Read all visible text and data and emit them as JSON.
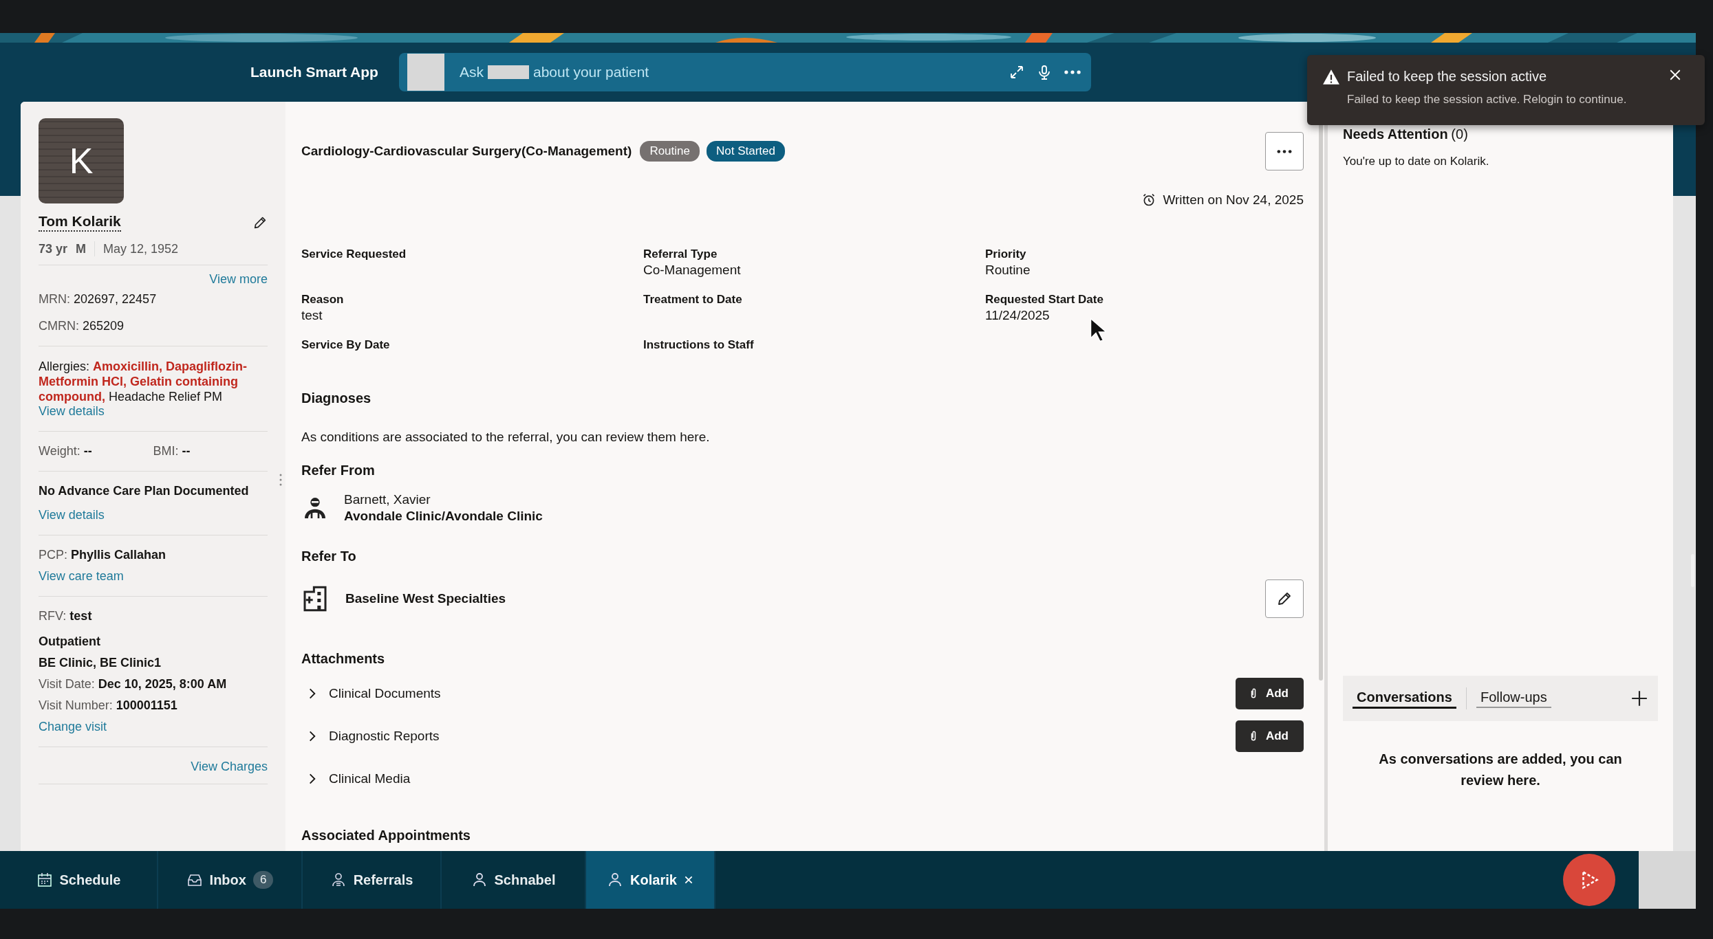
{
  "header": {
    "launch_label": "Launch Smart App",
    "assistant": {
      "prompt_before": "Ask",
      "prompt_after": "about your patient"
    }
  },
  "toast": {
    "title": "Failed to keep the session active",
    "message": "Failed to keep the session active. Relogin to continue."
  },
  "patient": {
    "initial": "K",
    "name": "Tom Kolarik",
    "age": "73 yr",
    "sex": "M",
    "birth_date": "May 12, 1952",
    "view_more": "View more",
    "ids": [
      {
        "label": "MRN:",
        "value": "202697, 22457"
      },
      {
        "label": "CMRN:",
        "value": "265209"
      }
    ],
    "allergies": "Allergies: **Amoxicillin, Dapagliflozin-Metformin HCl, Gelatin containing compound,** Headache Relief PM",
    "allergies_link": "View details",
    "measures": [
      {
        "label": "Weight:",
        "value": "--"
      },
      {
        "label": "BMI:",
        "value": "--"
      }
    ],
    "care_plan": "No Advance Care Plan Documented",
    "care_plan_link": "View details",
    "pcp": {
      "label": "PCP:",
      "value": "Phyllis Callahan"
    },
    "care_team_link": "View care team",
    "rfv": {
      "label": "RFV:",
      "value": "test"
    },
    "encounter_type": "Outpatient",
    "location": "BE Clinic, BE Clinic1",
    "visit": [
      {
        "label": "Visit Date:",
        "value": "Dec 10, 2025, 8:00 AM"
      },
      {
        "label": "Visit Number:",
        "value": "100001151"
      }
    ],
    "change_visit": "Change visit",
    "view_charges": "View Charges"
  },
  "referral": {
    "title": "Cardiology-Cardiovascular Surgery(Co-Management)",
    "badges": [
      {
        "label": "Routine",
        "color": "#767170"
      },
      {
        "label": "Not Started",
        "color": "#0d5e80"
      }
    ],
    "written": "Written on Nov 24, 2025",
    "fields": [
      {
        "label": "Service Requested"
      },
      {
        "label": "Referral Type",
        "value": "Co-Management"
      },
      {
        "label": "Priority",
        "value": "Routine"
      },
      {
        "label": "Reason",
        "value": "test"
      },
      {
        "label": "Treatment to Date"
      },
      {
        "label": "Requested Start Date",
        "value": "11/24/2025"
      },
      {
        "label": "Service By Date"
      },
      {
        "label": "Instructions to Staff"
      }
    ],
    "diagnoses": {
      "heading": "Diagnoses",
      "empty": "As conditions are associated to the referral, you can review them here."
    },
    "refer_from": {
      "heading": "Refer From",
      "name": "Barnett, Xavier",
      "organization": "Avondale Clinic/Avondale Clinic"
    },
    "refer_to": {
      "heading": "Refer To",
      "organization": "Baseline West Specialties"
    },
    "attachments": {
      "heading": "Attachments",
      "items": [
        {
          "label": "Clinical Documents",
          "expanded": false,
          "action": "Add"
        },
        {
          "label": "Diagnostic Reports",
          "expanded": false,
          "action": "Add"
        },
        {
          "label": "Clinical Media",
          "expanded": false
        }
      ]
    },
    "appointments_heading": "Associated Appointments"
  },
  "side": {
    "attention_title": "Needs Attention",
    "attention_count": "(0)",
    "attention_text": "You're up to date on Kolarik.",
    "tabs": [
      {
        "label": "Conversations",
        "selected": true
      },
      {
        "label": "Follow-ups",
        "selected": false
      }
    ],
    "empty": "As conversations are added, you can review here."
  },
  "bottom_nav": {
    "tabs": [
      {
        "label": "Schedule",
        "kind": "schedule",
        "selected": false,
        "closable": false
      },
      {
        "label": "Inbox",
        "kind": "inbox",
        "count": "6",
        "selected": false,
        "closable": false
      },
      {
        "label": "Referrals",
        "kind": "worklist",
        "selected": false,
        "closable": false
      },
      {
        "label": "Schnabel",
        "kind": "patient",
        "selected": false,
        "closable": false
      },
      {
        "label": "Kolarik",
        "kind": "patient",
        "selected": true,
        "closable": true
      }
    ]
  }
}
